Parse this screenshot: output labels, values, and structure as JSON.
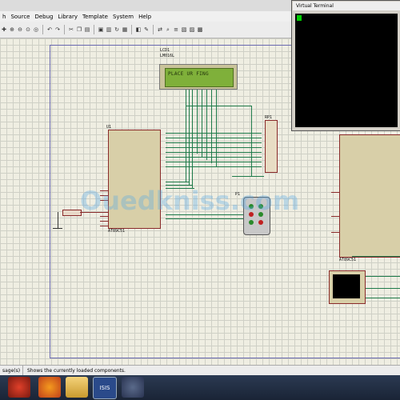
{
  "menubar": {
    "items": [
      "h",
      "Source",
      "Debug",
      "Library",
      "Template",
      "System",
      "Help"
    ]
  },
  "toolbar": {
    "icons": [
      "plus-icon",
      "zoom-in-icon",
      "zoom-out-icon",
      "zoom-area-icon",
      "zoom-fit-icon",
      "undo-icon",
      "redo-icon",
      "cut-icon",
      "copy-icon",
      "paste-icon",
      "block-copy-icon",
      "block-move-icon",
      "block-rotate-icon",
      "block-delete-icon",
      "pick-device-icon",
      "make-device-icon",
      "wire-autoroute-icon",
      "search-icon",
      "property-icon",
      "netlist-icon",
      "bom-icon",
      "erc-icon"
    ]
  },
  "schematic": {
    "lcd": {
      "ref": "LCD1",
      "model": "LM016L",
      "display_text": "PLACE UR FING"
    },
    "mcu1": {
      "ref": "U1",
      "model": "AT89C51"
    },
    "mcu2": {
      "model": "AT89C51"
    },
    "rp": {
      "ref": "RP1"
    },
    "connector": {
      "ref": "P1"
    }
  },
  "virtual_terminal": {
    "title": "Virtual Terminal"
  },
  "watermark": {
    "text": "Ouedkniss.com"
  },
  "statusbar": {
    "left": "sage(s)",
    "text": "Shows the currently loaded components."
  },
  "taskbar": {
    "apps": [
      "start-icon",
      "firefox-icon",
      "folder-icon",
      "isis-icon",
      "app-icon"
    ],
    "isis_label": "ISIS"
  }
}
